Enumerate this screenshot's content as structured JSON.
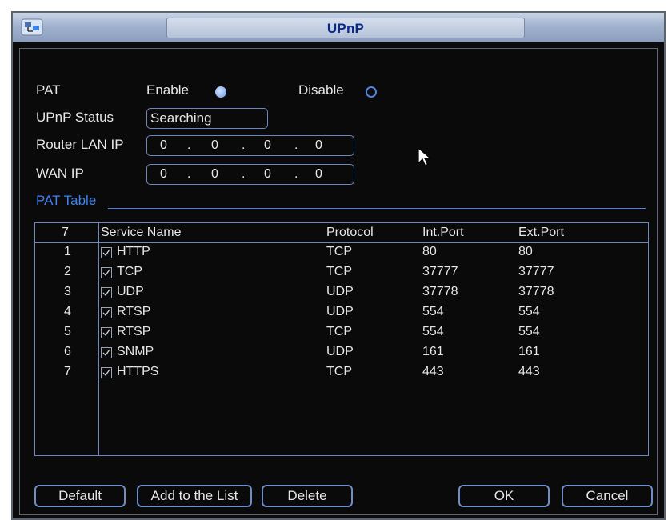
{
  "window": {
    "title": "UPnP"
  },
  "pat": {
    "label": "PAT",
    "enable_label": "Enable",
    "disable_label": "Disable",
    "selected": "Enable"
  },
  "upnp_status": {
    "label": "UPnP Status",
    "value": "Searching"
  },
  "router_lan_ip": {
    "label": "Router LAN IP",
    "octets": [
      "0",
      "0",
      "0",
      "0"
    ]
  },
  "wan_ip": {
    "label": "WAN IP",
    "octets": [
      "0",
      "0",
      "0",
      "0"
    ]
  },
  "pat_table": {
    "title": "PAT Table",
    "count": "7",
    "columns": {
      "service": "Service Name",
      "protocol": "Protocol",
      "int_port": "Int.Port",
      "ext_port": "Ext.Port"
    },
    "rows": [
      {
        "no": "1",
        "checked": true,
        "service": "HTTP",
        "protocol": "TCP",
        "int_port": "80",
        "ext_port": "80"
      },
      {
        "no": "2",
        "checked": true,
        "service": "TCP",
        "protocol": "TCP",
        "int_port": "37777",
        "ext_port": "37777"
      },
      {
        "no": "3",
        "checked": true,
        "service": "UDP",
        "protocol": "UDP",
        "int_port": "37778",
        "ext_port": "37778"
      },
      {
        "no": "4",
        "checked": true,
        "service": "RTSP",
        "protocol": "UDP",
        "int_port": "554",
        "ext_port": "554"
      },
      {
        "no": "5",
        "checked": true,
        "service": "RTSP",
        "protocol": "TCP",
        "int_port": "554",
        "ext_port": "554"
      },
      {
        "no": "6",
        "checked": true,
        "service": "SNMP",
        "protocol": "UDP",
        "int_port": "161",
        "ext_port": "161"
      },
      {
        "no": "7",
        "checked": true,
        "service": "HTTPS",
        "protocol": "TCP",
        "int_port": "443",
        "ext_port": "443"
      }
    ]
  },
  "buttons": {
    "default": "Default",
    "add": "Add to the List",
    "delete": "Delete",
    "ok": "OK",
    "cancel": "Cancel"
  },
  "colors": {
    "accent": "#3f82e8",
    "title_text": "#0a2a8a",
    "background": "#0a0a0a"
  }
}
